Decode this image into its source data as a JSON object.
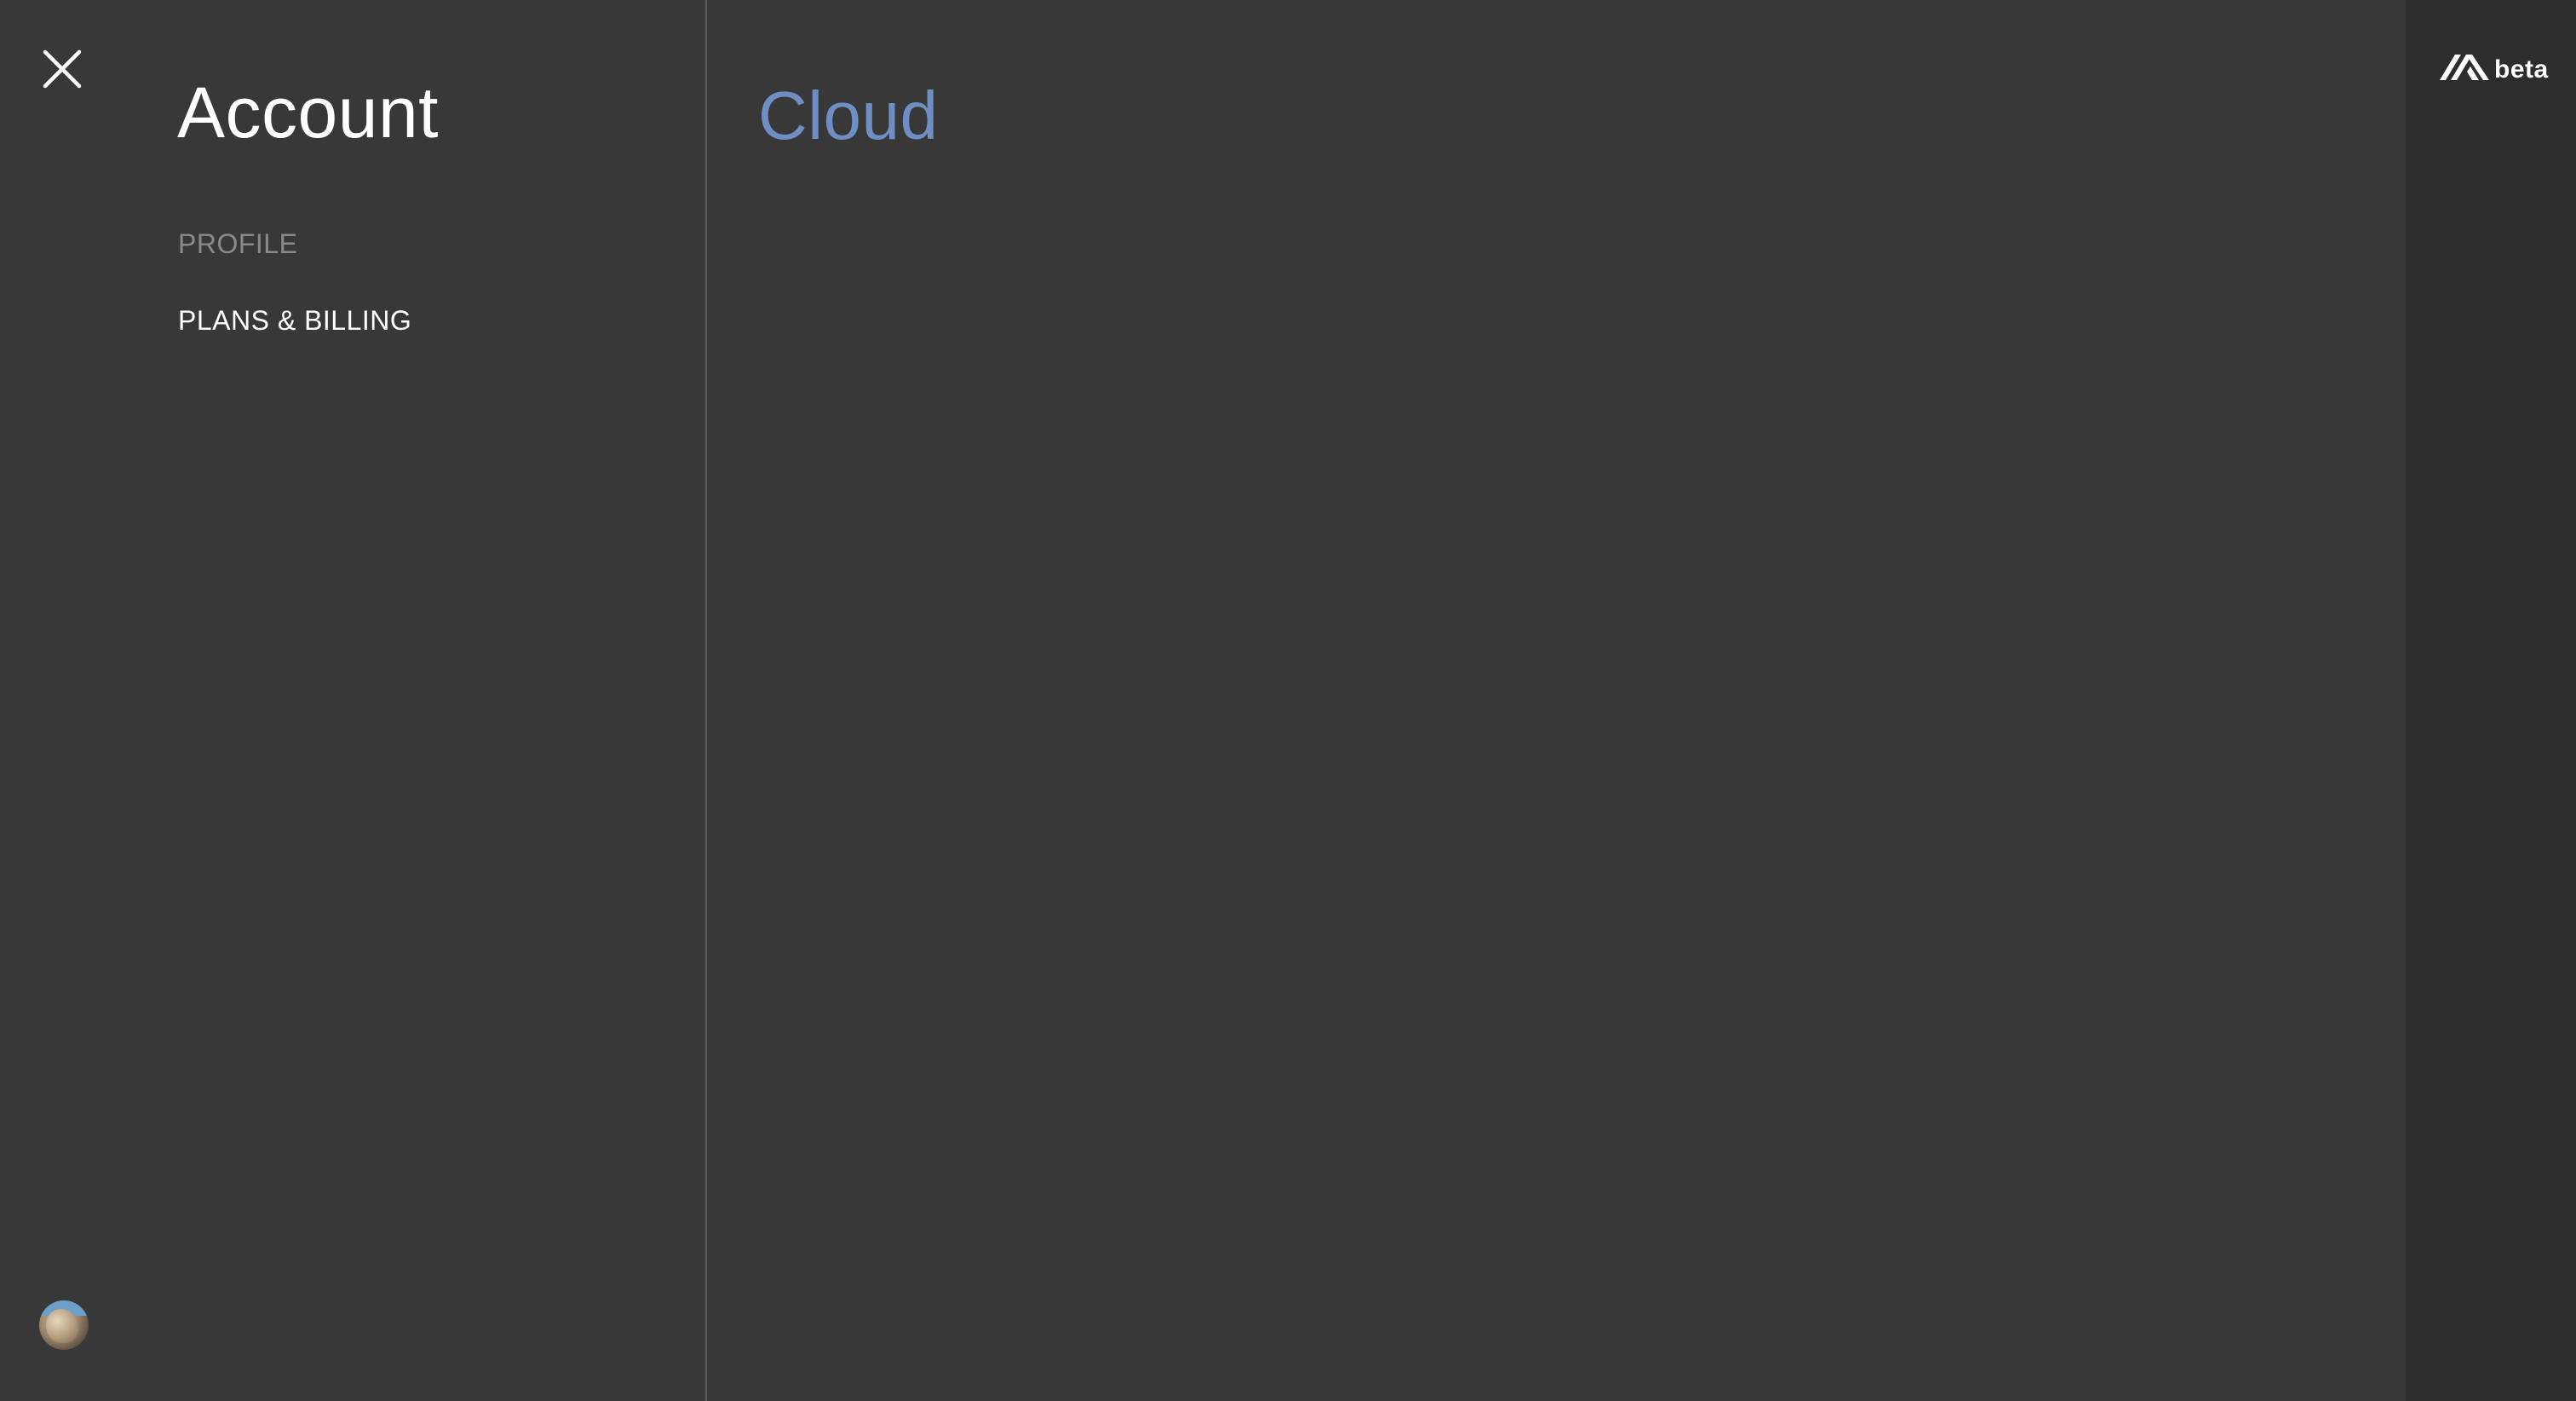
{
  "left_panel": {
    "title": "Account",
    "nav": {
      "items": [
        {
          "label": "PROFILE",
          "state": "inactive"
        },
        {
          "label": "PLANS & BILLING",
          "state": "active"
        }
      ]
    }
  },
  "main": {
    "title": "Cloud"
  },
  "brand": {
    "badge": "beta"
  },
  "icons": {
    "close": "close-icon",
    "logo": "brand-logo-icon",
    "avatar": "user-avatar"
  },
  "colors": {
    "background": "#383838",
    "rail": "#2d2d2d",
    "accent": "#6f8fc4",
    "muted": "#8a8a8a",
    "text": "#ffffff"
  }
}
